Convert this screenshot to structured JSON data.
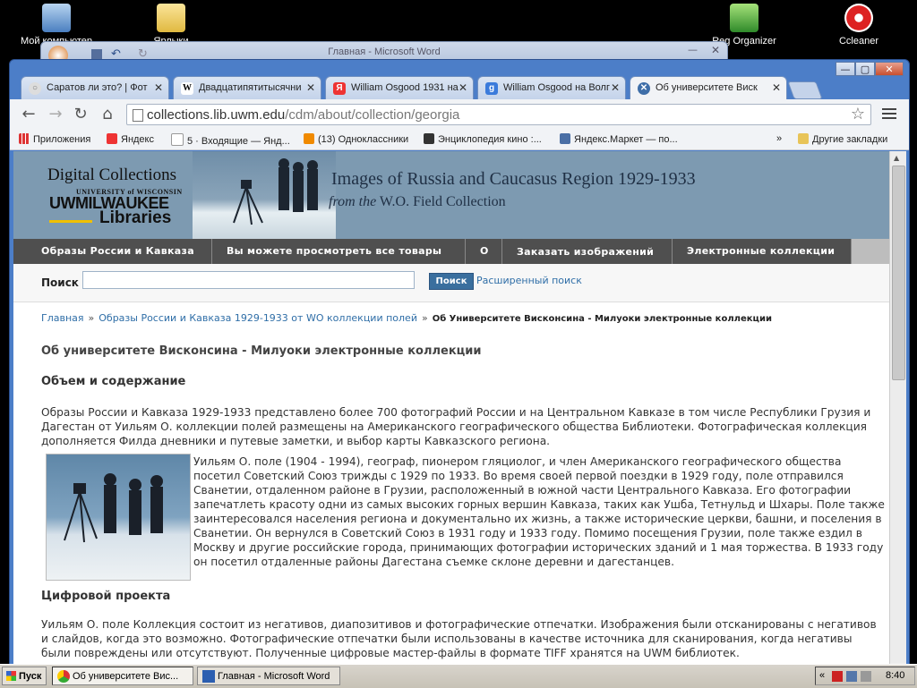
{
  "desktop": {
    "icons": [
      {
        "label": "Мой компьютер"
      },
      {
        "label": "Ярлыки"
      },
      {
        "label": "Reg Organizer"
      },
      {
        "label": "Ccleaner"
      }
    ]
  },
  "word_window": {
    "title": "Главная - Microsoft Word"
  },
  "chrome": {
    "tabs": [
      {
        "label": "Саратов ли это? | Фот"
      },
      {
        "label": "Двадцатипятитысячни"
      },
      {
        "label": "William Osgood 1931 на"
      },
      {
        "label": "William Osgood на Волг"
      },
      {
        "label": "Об университете Виск"
      }
    ],
    "url_host": "collections.lib.uwm.edu",
    "url_path": "/cdm/about/collection/georgia",
    "bookmarks": [
      {
        "label": "Приложения"
      },
      {
        "label": "Яндекс"
      },
      {
        "label": "5 · Входящие — Янд..."
      },
      {
        "label": "(13) Одноклассники"
      },
      {
        "label": "Энциклопедия кино :..."
      },
      {
        "label": "Яндекс.Маркет — по..."
      },
      {
        "label": "»"
      },
      {
        "label": "Другие закладки"
      }
    ]
  },
  "site": {
    "logo": {
      "line1": "Digital Collections",
      "line2": "UNIVERSITY of WISCONSIN",
      "line3": "UWMILWAUKEE",
      "line4": "Libraries"
    },
    "banner_title": "Images of Russia and Caucasus Region 1929-1933",
    "banner_sub_italic": "from the",
    "banner_sub_rest": "W.O. Field Collection",
    "nav": [
      {
        "label": "Образы России и Кавказа"
      },
      {
        "label": "Вы можете просмотреть все товары"
      },
      {
        "label": "О"
      },
      {
        "label": "Заказать изображений"
      },
      {
        "label": "Электронные коллекции"
      }
    ],
    "search_label": "Поиск",
    "search_button": "Поиск",
    "advanced_search": "Расширенный поиск",
    "breadcrumb": {
      "home": "Главная",
      "sep": "»",
      "collection": "Образы России и Кавказа 1929-1933 от WO коллекции полей",
      "current": "Об Университете Висконсина - Милуоки электронные коллекции"
    },
    "page_title": "Об университете Висконсина - Милуоки электронные коллекции",
    "section1_title": "Объем и содержание",
    "section1_text": "Образы России и Кавказа 1929-1933 представлено более 700 фотографий России и на Центральном Кавказе в том числе Республики Грузия и Дагестан от Уильям О. коллекции полей размещены на Американского географического общества Библиотеки. Фотографическая коллекция дополняется Филда дневники и путевые заметки, и выбор карты Кавказского региона.",
    "bio_text": "Уильям О. поле (1904 - 1994), географ, пионером гляциолог, и член Американского географического общества посетил Советский Союз трижды с 1929 по 1933. Во время своей первой поездки в 1929 году, поле отправился Сванетии, отдаленном районе в Грузии, расположенный в южной части Центрального Кавказа. Его фотографии запечатлеть красоту одни из самых высоких горных вершин Кавказа, таких как Ушба, Тетнульд и Шхары. Поле также заинтересовался населения региона и документально их жизнь, а также исторические церкви, башни, и поселения в Сванетии. Он вернулся в Советский Союз в 1931 году и 1933 году. Помимо посещения Грузии, поле также ездил в Москву и другие российские города, принимающих фотографии исторических зданий и 1 мая торжества. В 1933 году он посетил отдаленные районы Дагестана съемке склоне деревни и дагестанцев.",
    "section2_title": "Цифровой проекта",
    "section2_text": "Уильям О. поле Коллекция состоит из негативов, диапозитивов и фотографические отпечатки. Изображения были отсканированы с негативов и слайдов, когда это возможно. Фотографические отпечатки были использованы в качестве источника для сканирования, когда негативы были повреждены или отсутствуют. Полученные цифровые мастер-файлы в формате TIFF хранятся на UWM библиотек."
  },
  "taskbar": {
    "start": "Пуск",
    "items": [
      {
        "label": "Об университете Вис..."
      },
      {
        "label": "Главная - Microsoft Word"
      }
    ],
    "tray_lang": "«",
    "clock": "8:40"
  }
}
